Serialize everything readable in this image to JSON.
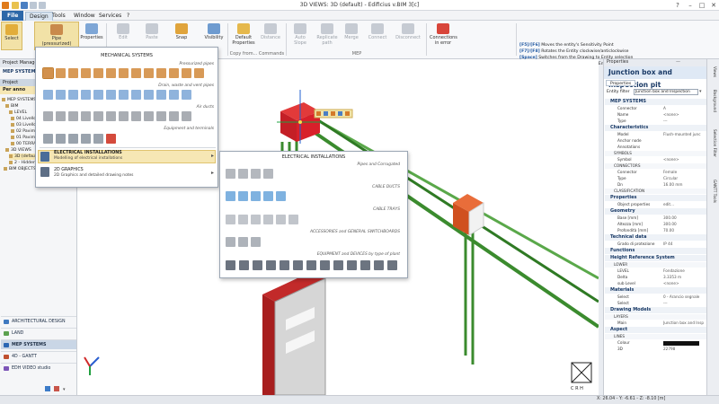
{
  "window": {
    "title": "3D VIEWS: 3D (default) - Edificius v.BIM 3[c]"
  },
  "menu_tabs": [
    {
      "label": "File"
    },
    {
      "label": "Design"
    },
    {
      "label": "Tools"
    },
    {
      "label": "Window"
    },
    {
      "label": "Services"
    },
    {
      "label": "?"
    }
  ],
  "ribbon": {
    "select": "Select",
    "pipe": "Pipe",
    "pipe_sub": "(pressurized)",
    "properties": "Properties",
    "edit": "Edit",
    "paste": "Paste",
    "snap": "Snap",
    "visibility": "Visibility",
    "default_properties": "Default Properties",
    "distance": "Distance",
    "auto_slope": "Auto Slope",
    "replicate_path": "Replicate path",
    "merge": "Merge",
    "connect": "Connect",
    "disconnect": "Disconnect",
    "connections_in_error": "Connections in error",
    "group_copy": "Copy from...",
    "group_commands": "Commands",
    "group_mep": "MEP"
  },
  "help": {
    "lines": [
      {
        "keys": "[F5]/[F6]",
        "text": "Moves the entity's Sensitivity Point"
      },
      {
        "keys": "[F7]/[F8]",
        "text": "Rotates the Entity clockwise/anticlockwise"
      },
      {
        "keys": "[Space]",
        "text": "Switches from the Drawing to Entity selection"
      },
      {
        "keys": "[Ctrl]+[Space]",
        "text": "Selects the following Entity that is below the currently selected entity ('Y')"
      }
    ]
  },
  "left_panel": {
    "title": "Project Manager",
    "mep_header": "MEP SYSTEMS",
    "project_label": "Project",
    "per_label": "Per anno",
    "tree": [
      {
        "label": "MEP SYSTEMS"
      },
      {
        "label": "BIM"
      },
      {
        "label": "LEVEL"
      },
      {
        "label": "04 Livello"
      },
      {
        "label": "03 Livello"
      },
      {
        "label": "02 Pavimento"
      },
      {
        "label": "01 Pavimento"
      },
      {
        "label": "00 TERRA"
      },
      {
        "label": "3D VIEWS"
      },
      {
        "label": "3D (default)"
      },
      {
        "label": "2 - Hidden"
      },
      {
        "label": "BIM OBJECTS"
      }
    ],
    "modules": [
      {
        "label": "ARCHITECTURAL DESIGN",
        "color": "#3f79c0"
      },
      {
        "label": "LAND",
        "color": "#5ca14f"
      },
      {
        "label": "MEP SYSTEMS",
        "color": "#2a66b3"
      },
      {
        "label": "4D - GANTT",
        "color": "#c0502f"
      },
      {
        "label": "EDH VIDEO studio",
        "color": "#7d56b8"
      }
    ]
  },
  "mech_menu": {
    "title": "MECHANICAL SYSTEMS",
    "sections": [
      {
        "label": "Pressurized pipes"
      },
      {
        "label": "Drain, waste and vent pipes"
      },
      {
        "label": "Air ducts"
      },
      {
        "label": "Equipment and terminals"
      }
    ],
    "electrical": {
      "title": "ELECTRICAL INSTALLATIONS",
      "desc": "Modelling of electrical installations"
    },
    "graphics": {
      "title": "2D GRAPHICS",
      "desc": "2D Graphics and detailed drawing notes"
    }
  },
  "elec_menu": {
    "title": "ELECTRICAL INSTALLATIONS",
    "sections": [
      {
        "label": "Pipes and Corrugated"
      },
      {
        "label": "CABLE DUCTS"
      },
      {
        "label": "CABLE TRAYS"
      },
      {
        "label": "ACCESSORIES and GENERAL SWITCHBOARDS"
      },
      {
        "label": "EQUIPMENT and DEVICES by type of plant"
      }
    ]
  },
  "properties": {
    "panel_title": "Properties",
    "header": "Junction box and Inspection pit",
    "tab": "Properties",
    "filter_label": "Entity filter",
    "filter_value": "Junction box and Inspection",
    "rows": [
      {
        "kind": "sec",
        "k": "MEP SYSTEMS"
      },
      {
        "kind": "row",
        "k": "Connector",
        "v": "A"
      },
      {
        "kind": "row",
        "k": "Name",
        "v": "<none>"
      },
      {
        "kind": "row",
        "k": "Type",
        "v": "---"
      },
      {
        "kind": "sec",
        "k": "Characteristics"
      },
      {
        "kind": "row",
        "k": "Model",
        "v": "Flush-mounted junc"
      },
      {
        "kind": "row",
        "k": "Anchor node",
        "v": ""
      },
      {
        "kind": "row",
        "k": "Annotations",
        "v": ""
      },
      {
        "kind": "sub",
        "k": "SYMBOLS"
      },
      {
        "kind": "row",
        "k": "Symbol",
        "v": "<none>"
      },
      {
        "kind": "sub",
        "k": "CONNECTORS"
      },
      {
        "kind": "row",
        "k": "Connector",
        "v": "Female"
      },
      {
        "kind": "row",
        "k": "Type",
        "v": "Circular"
      },
      {
        "kind": "row",
        "k": "Dn",
        "v": "16.00 mm"
      },
      {
        "kind": "sub",
        "k": "CLASSIFICATION"
      },
      {
        "kind": "sec",
        "k": "Properties"
      },
      {
        "kind": "row",
        "k": "Object properties",
        "v": "edit..."
      },
      {
        "kind": "sec",
        "k": "Geometry"
      },
      {
        "kind": "row",
        "k": "Base [mm]",
        "v": "300.00"
      },
      {
        "kind": "row",
        "k": "Altezza [mm]",
        "v": "300.00"
      },
      {
        "kind": "row",
        "k": "Profondità [mm]",
        "v": "70.00"
      },
      {
        "kind": "sec",
        "k": "Technical data"
      },
      {
        "kind": "row",
        "k": "Grado di protezione",
        "v": "IP 44"
      },
      {
        "kind": "sec",
        "k": "Functions"
      },
      {
        "kind": "sec",
        "k": "Height Reference System"
      },
      {
        "kind": "sub",
        "k": "LOWER"
      },
      {
        "kind": "row",
        "k": "LEVEL",
        "v": "Fondazione"
      },
      {
        "kind": "row",
        "k": "Delta",
        "v": "3.3353 m"
      },
      {
        "kind": "row",
        "k": "sub Level",
        "v": "<none>"
      },
      {
        "kind": "sec",
        "k": "Materials"
      },
      {
        "kind": "row",
        "k": "Select",
        "v": "0 - Arancio segnale"
      },
      {
        "kind": "row",
        "k": "Select",
        "v": "---"
      },
      {
        "kind": "sec",
        "k": "Drawing Models"
      },
      {
        "kind": "sub",
        "k": "LAYERS"
      },
      {
        "kind": "row",
        "k": "Main",
        "v": "Junction box and Insp"
      },
      {
        "kind": "sec",
        "k": "Aspect"
      },
      {
        "kind": "sub",
        "k": "LINES"
      },
      {
        "kind": "row",
        "k": "Colour",
        "v": ""
      },
      {
        "kind": "row",
        "k": "3D",
        "v": "22798"
      }
    ]
  },
  "right_strip": [
    "Views",
    "Background",
    "Selection Filter",
    "GANTT Tools"
  ],
  "status": {
    "coords": "X: 26.04 - Y: -6.61 - Z: -8.10 [m]"
  },
  "viewcube": {
    "label": "C R H"
  },
  "colors": {
    "accent": "#2c67a8",
    "highlight": "#f6e7b4",
    "junction_box": "#d8202a",
    "conduit": "#3b8b2e"
  }
}
